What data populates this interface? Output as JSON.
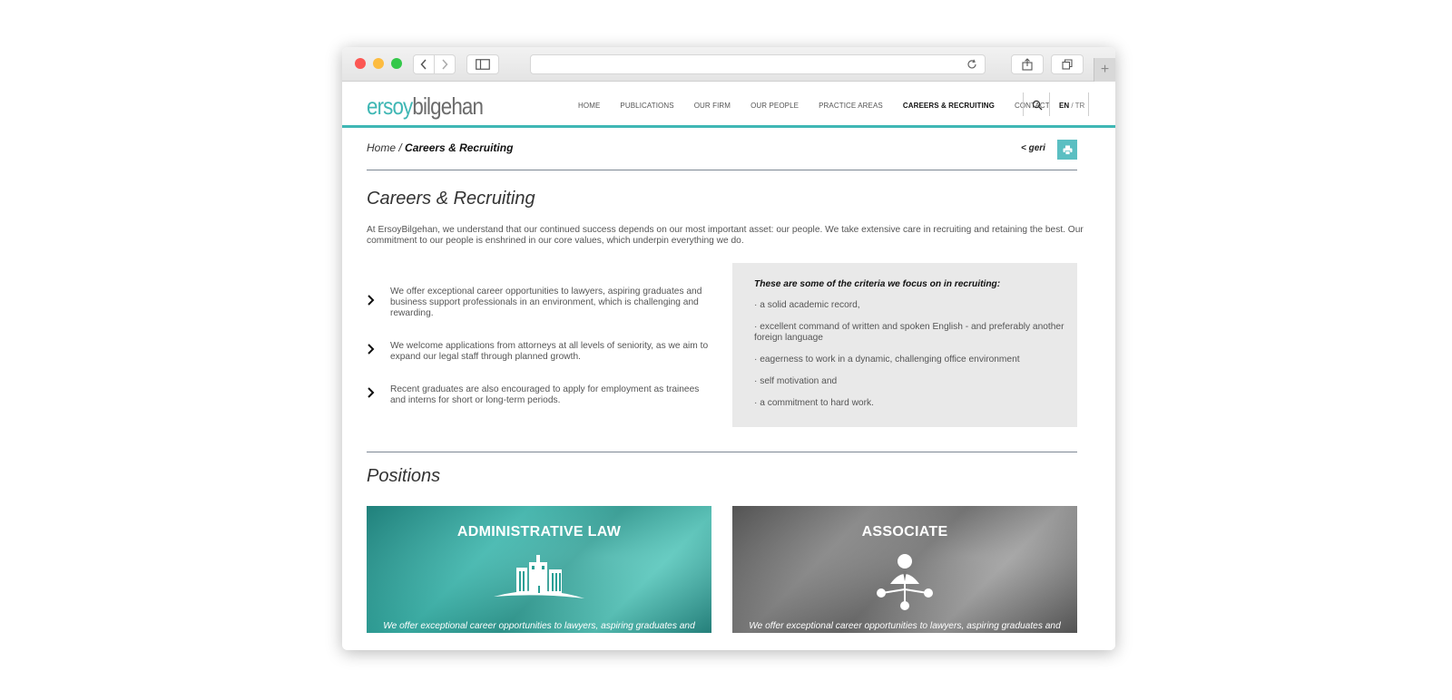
{
  "browser": {
    "url": "",
    "new_tab_label": "+"
  },
  "header": {
    "logo_part1": "ersoy",
    "logo_part2": "bilgehan",
    "menu": [
      {
        "label": "HOME"
      },
      {
        "label": "PUBLICATIONS"
      },
      {
        "label": "OUR FIRM"
      },
      {
        "label": "OUR PEOPLE"
      },
      {
        "label": "PRACTICE AREAS"
      },
      {
        "label": "CAREERS & RECRUITING",
        "active": true
      },
      {
        "label": "CONTACT"
      }
    ],
    "lang_active": "EN",
    "lang_sep": " / ",
    "lang_other": "TR",
    "accent": "#3fb7b4"
  },
  "breadcrumb": {
    "home": "Home",
    "sep": " / ",
    "current": "Careers & Recruiting",
    "back": "< geri"
  },
  "main": {
    "title": "Careers & Recruiting",
    "intro": "At ErsoyBilgehan, we understand that our continued success depends on our most important asset: our people. We take extensive care in recruiting and retaining the best. Our commitment to our people is enshrined in our core values, which underpin everything we do.",
    "bullets": [
      "We offer exceptional career opportunities to lawyers, aspiring graduates and business support professionals in an environment, which is challenging and rewarding.",
      "We welcome applications from attorneys at all levels of seniority, as we aim to expand our legal staff through planned growth.",
      "Recent graduates are also encouraged to apply for employment as trainees and interns for short or long-term periods."
    ],
    "criteria_title": "These are some of the criteria we focus on in recruiting:",
    "criteria": [
      "· a solid academic record,",
      "· excellent command of written and spoken English - and preferably another foreign language",
      "· eagerness to work in a dynamic, challenging office environment",
      "· self motivation and",
      "· a commitment to hard work."
    ]
  },
  "positions": {
    "title": "Positions",
    "cards": [
      {
        "title": "ADMINISTRATIVE LAW",
        "desc": "We offer exceptional career opportunities to lawyers, aspiring graduates and"
      },
      {
        "title": "ASSOCIATE",
        "desc": "We offer exceptional career opportunities to lawyers, aspiring graduates and"
      }
    ]
  }
}
